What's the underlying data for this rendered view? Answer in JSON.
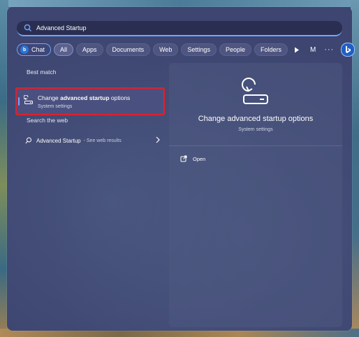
{
  "search": {
    "query": "Advanced Startup"
  },
  "filters": {
    "chat": "Chat",
    "all": "All",
    "apps": "Apps",
    "documents": "Documents",
    "web": "Web",
    "settings": "Settings",
    "people": "People",
    "folders": "Folders",
    "avatar_letter": "M",
    "more": "···"
  },
  "left": {
    "best_match_title": "Best match",
    "best_match": {
      "title_prefix": "Change ",
      "title_bold": "advanced startup",
      "title_suffix": " options",
      "subtitle": "System settings"
    },
    "web_title": "Search the web",
    "web_result": {
      "text": "Advanced Startup",
      "see": "- See web results"
    }
  },
  "preview": {
    "title": "Change advanced startup options",
    "subtitle": "System settings",
    "open_label": "Open"
  },
  "colors": {
    "accent": "#6fa8ff",
    "highlight_border": "#e0202a",
    "panel": "#3d4570"
  }
}
